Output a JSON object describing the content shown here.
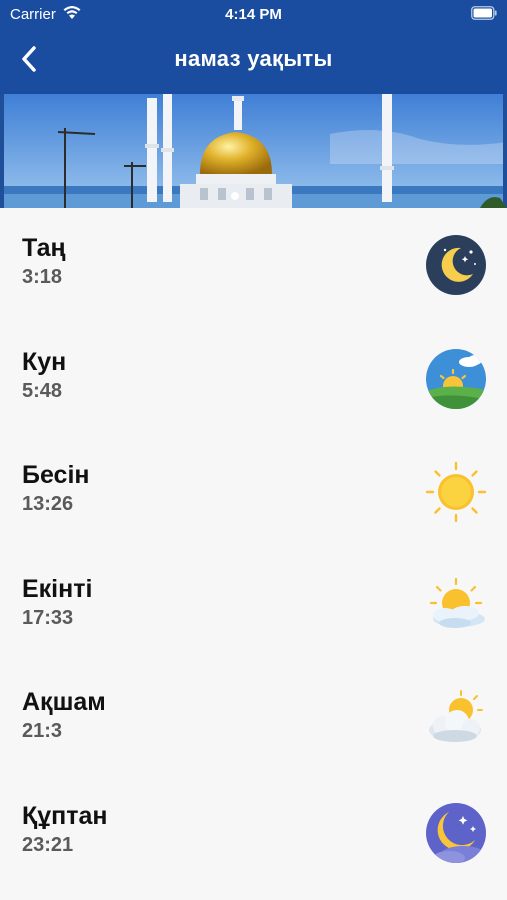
{
  "status_bar": {
    "carrier": "Carrier",
    "time": "4:14 PM"
  },
  "nav": {
    "title": "намаз уақыты"
  },
  "colors": {
    "nav_bg": "#1a4d9f",
    "page_bg": "#f7f7f8"
  },
  "prayers": [
    {
      "name": "Таң",
      "time": "3:18",
      "icon": "night-moon-icon"
    },
    {
      "name": "Кун",
      "time": "5:48",
      "icon": "sunrise-icon"
    },
    {
      "name": "Бесін",
      "time": "13:26",
      "icon": "sun-icon"
    },
    {
      "name": "Екінті",
      "time": "17:33",
      "icon": "sun-cloud-icon"
    },
    {
      "name": "Ақшам",
      "time": "21:3",
      "icon": "cloud-sun-icon"
    },
    {
      "name": "Құптан",
      "time": "23:21",
      "icon": "moon-stars-icon"
    }
  ]
}
